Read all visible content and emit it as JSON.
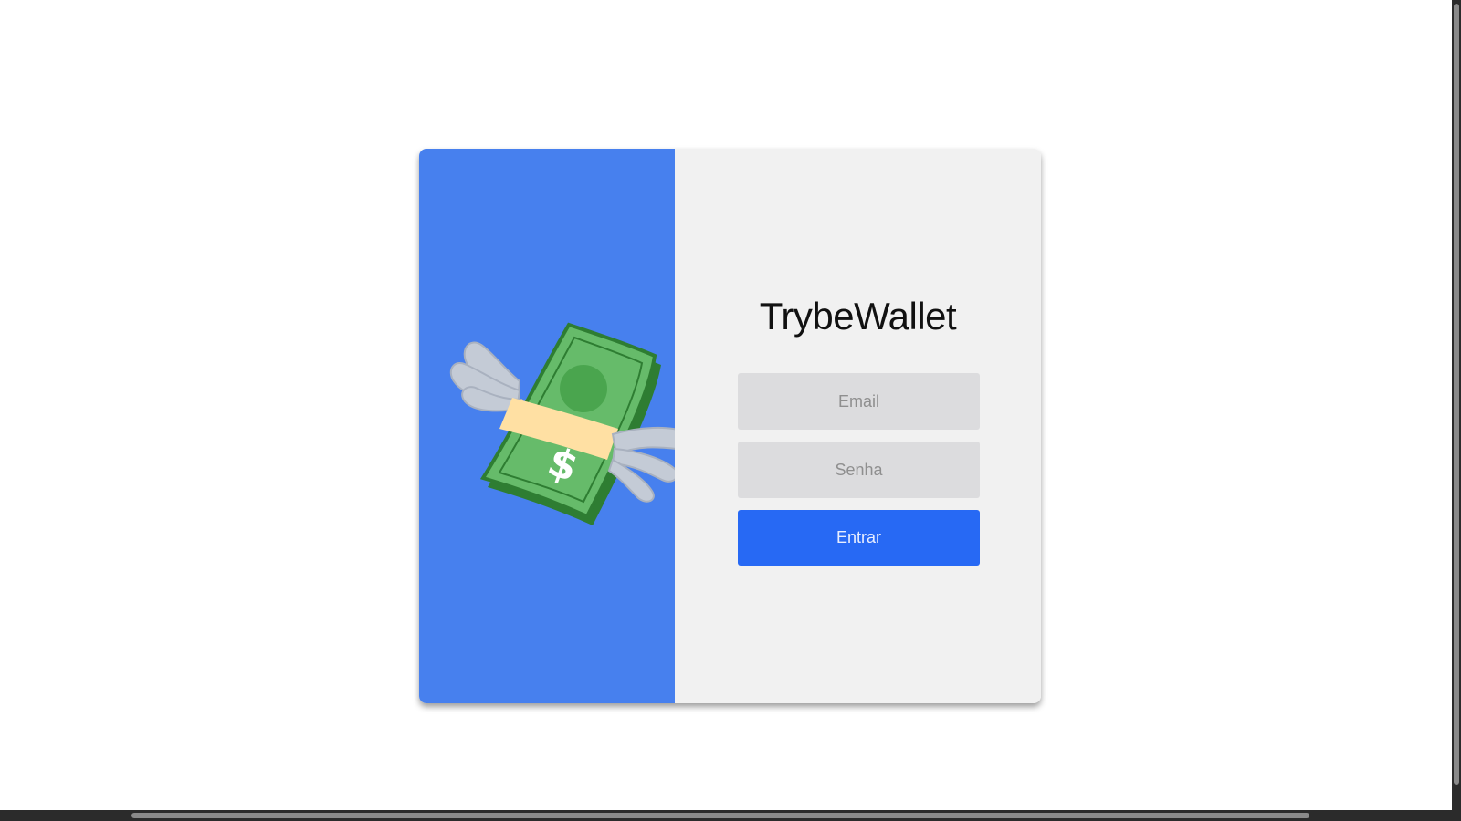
{
  "login": {
    "title": "TrybeWallet",
    "email_placeholder": "Email",
    "password_placeholder": "Senha",
    "submit_label": "Entrar"
  },
  "icons": {
    "illustration": "money-with-wings-icon"
  },
  "colors": {
    "page_background": "#ffffff",
    "left_panel": "#4780ee",
    "right_panel": "#f1f1f1",
    "input_background": "#dcdcde",
    "button_primary": "#2769f4",
    "scrollbar_track": "#2b2b2b",
    "scrollbar_thumb": "#8a8a8a"
  }
}
